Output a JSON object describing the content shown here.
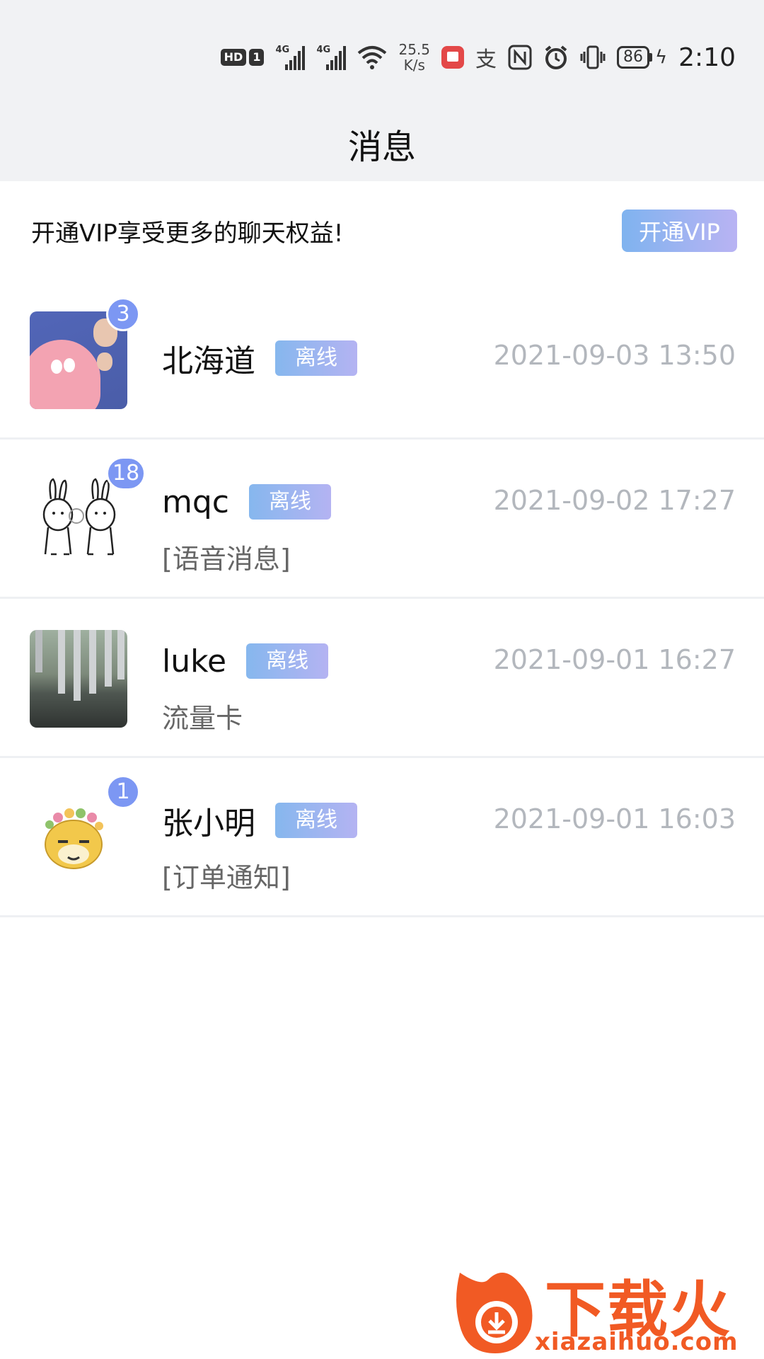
{
  "status_bar": {
    "hd_label": "HD",
    "sim_label": "1",
    "signal1_label": "4G",
    "signal2_label": "4G",
    "speed_value": "25.5",
    "speed_unit": "K/s",
    "alipay_glyph": "支",
    "battery_level": "86",
    "time": "2:10",
    "icons": [
      "hd-icon",
      "signal-icon",
      "signal-icon",
      "wifi-icon",
      "app-icon",
      "alipay-icon",
      "nfc-icon",
      "alarm-icon",
      "vibrate-icon",
      "battery-icon",
      "charging-icon"
    ]
  },
  "header": {
    "title": "消息"
  },
  "vip_banner": {
    "text": "开通VIP享受更多的聊天权益!",
    "button_label": "开通VIP"
  },
  "conversations": [
    {
      "name": "北海道",
      "status": "离线",
      "time": "2021-09-03 13:50",
      "preview": "",
      "unread": "3",
      "avatar": "patrick-avatar"
    },
    {
      "name": "mqc",
      "status": "离线",
      "time": "2021-09-02 17:27",
      "preview": "[语音消息]",
      "unread": "18",
      "avatar": "rabbits-avatar"
    },
    {
      "name": "luke",
      "status": "离线",
      "time": "2021-09-01 16:27",
      "preview": "流量卡",
      "unread": "",
      "avatar": "building-photo-avatar"
    },
    {
      "name": "张小明",
      "status": "离线",
      "time": "2021-09-01 16:03",
      "preview": "[订单通知]",
      "unread": "1",
      "avatar": "doge-avatar"
    }
  ],
  "watermark": {
    "title": "下载火",
    "url": "xiazaihuo.com"
  },
  "colors": {
    "header_bg": "#f1f2f4",
    "badge": "#7c97f3",
    "tag_gradient_start": "#86b7ee",
    "tag_gradient_end": "#b4b3f2",
    "time_text": "#b3b7bd",
    "watermark": "#f15a24"
  }
}
